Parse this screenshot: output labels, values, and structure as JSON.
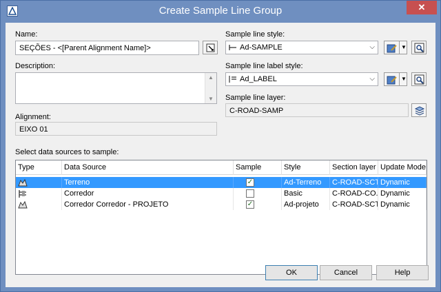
{
  "window": {
    "title": "Create Sample Line Group",
    "close_glyph": "✕"
  },
  "name": {
    "label": "Name:",
    "value": "SEÇÕES - <[Parent Alignment Name]>"
  },
  "description": {
    "label": "Description:",
    "value": ""
  },
  "alignment": {
    "label": "Alignment:",
    "value": "EIXO 01"
  },
  "sample_line_style": {
    "label": "Sample line style:",
    "value": "Ad-SAMPLE"
  },
  "sample_line_label_style": {
    "label": "Sample line label style:",
    "value": "Ad_LABEL"
  },
  "sample_line_layer": {
    "label": "Sample line layer:",
    "value": "C-ROAD-SAMP"
  },
  "sources": {
    "label": "Select data sources to sample:",
    "columns": [
      "Type",
      "Data Source",
      "Sample",
      "Style",
      "Section layer",
      "Update Mode"
    ],
    "rows": [
      {
        "type_icon": "surface-icon",
        "source": "Terreno",
        "sample": true,
        "style": "Ad-Terreno",
        "layer": "C-ROAD-SCTN",
        "mode": "Dynamic",
        "selected": true
      },
      {
        "type_icon": "corridor-icon",
        "source": "Corredor",
        "sample": false,
        "style": "Basic",
        "layer": "C-ROAD-CO...",
        "mode": "Dynamic",
        "selected": false
      },
      {
        "type_icon": "surface-icon",
        "source": "Corredor Corredor - PROJETO",
        "sample": true,
        "style": "Ad-projeto",
        "layer": "C-ROAD-SCTN",
        "mode": "Dynamic",
        "selected": false
      }
    ]
  },
  "buttons": {
    "ok": "OK",
    "cancel": "Cancel",
    "help": "Help"
  },
  "colors": {
    "titlebar": "#6f8fc0",
    "selection": "#3399ff",
    "close": "#c75050"
  }
}
